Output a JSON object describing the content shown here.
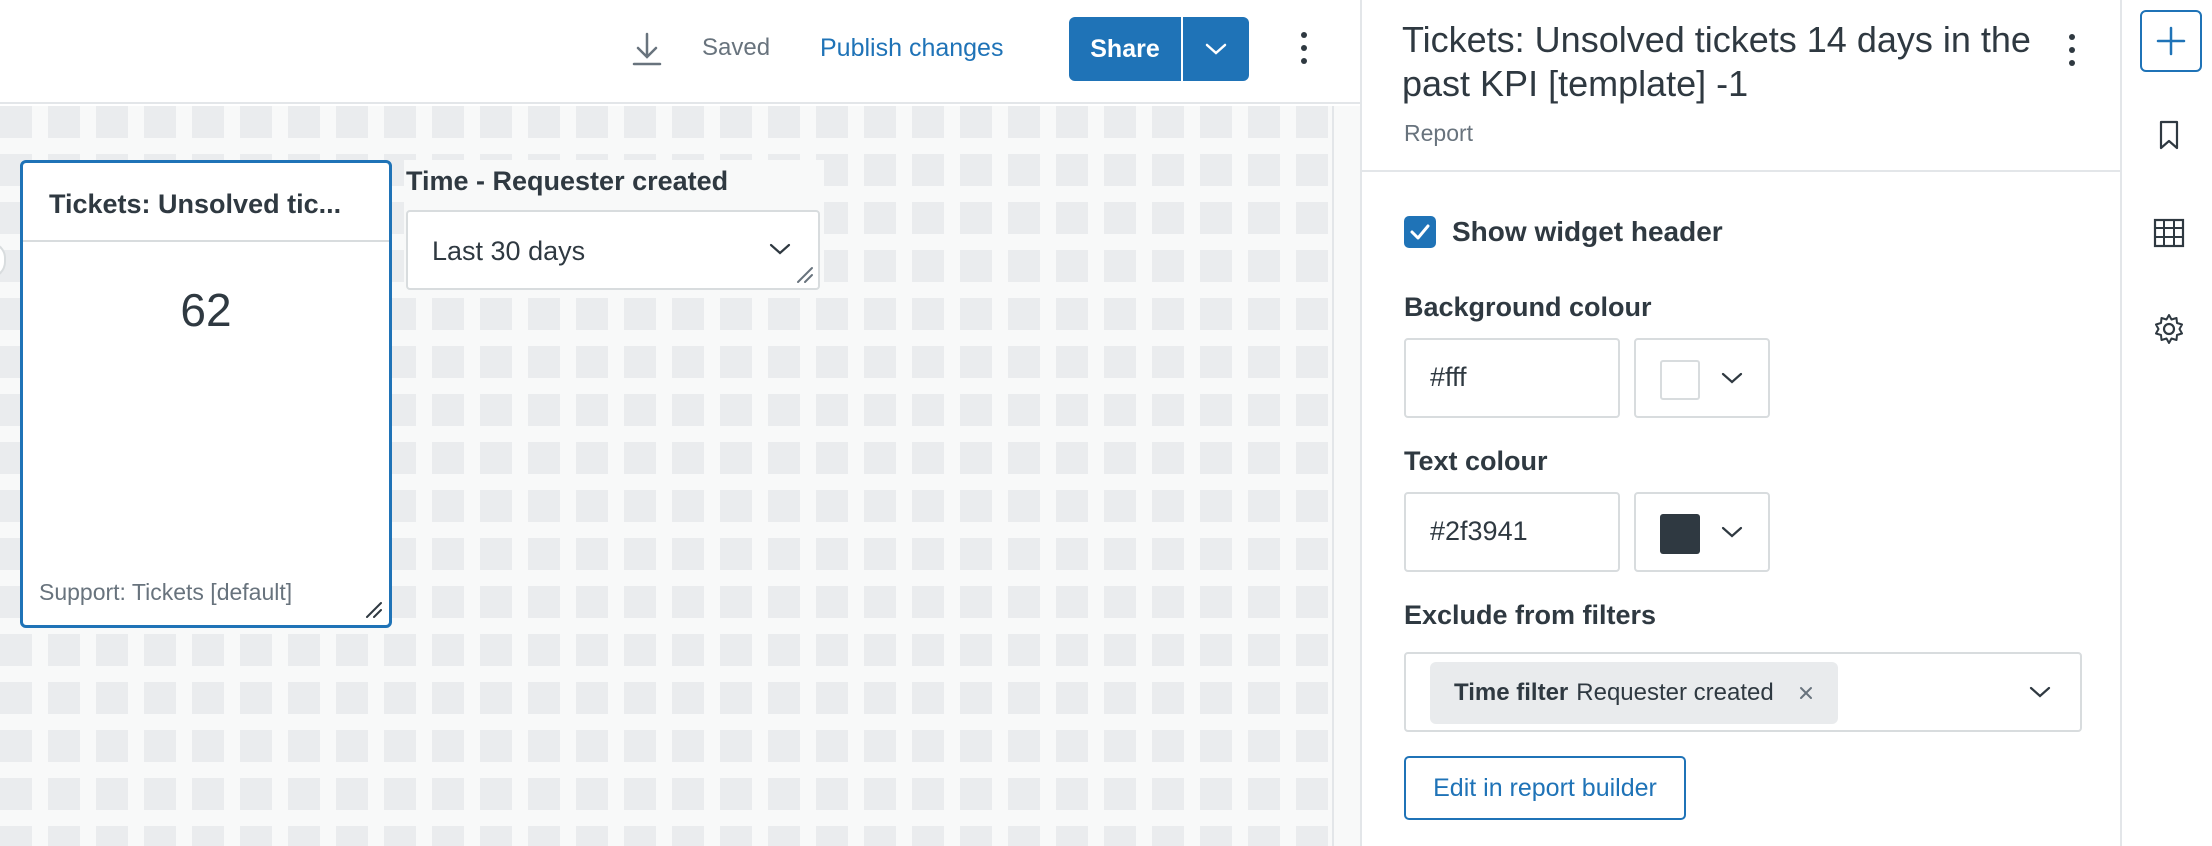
{
  "toolbar": {
    "download_icon": "download-icon",
    "saved_label": "Saved",
    "publish_label": "Publish changes",
    "share_label": "Share",
    "share_menu_icon": "chevron-down-icon",
    "more_icon": "kebab-icon"
  },
  "canvas": {
    "kpi_widget": {
      "title": "Tickets: Unsolved tic...",
      "value": "62",
      "source": "Support: Tickets [default]"
    },
    "filter_widget": {
      "label": "Time - Requester created",
      "selected": "Last 30 days"
    }
  },
  "panel": {
    "title": "Tickets: Unsolved tickets 14 days in the past KPI [template] -1",
    "subtitle": "Report",
    "show_header_label": "Show widget header",
    "show_header_checked": true,
    "background_label": "Background colour",
    "background_value": "#fff",
    "background_swatch": "#ffffff",
    "text_colour_label": "Text colour",
    "text_colour_value": "#2f3941",
    "text_swatch": "#2f3941",
    "exclude_label": "Exclude from filters",
    "exclude_tag_key": "Time filter",
    "exclude_tag_value": "Requester created",
    "edit_button": "Edit in report builder"
  },
  "rail": {
    "items": [
      "add-icon",
      "bookmark-icon",
      "table-icon",
      "settings-icon"
    ]
  },
  "colors": {
    "accent": "#1f73b7",
    "text": "#2f3941",
    "muted": "#68737d",
    "border": "#d8dcde"
  }
}
